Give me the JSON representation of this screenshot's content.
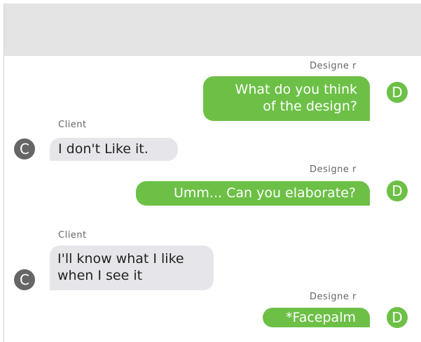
{
  "header": {
    "title": ""
  },
  "messages": [
    {
      "from": "designer",
      "sender": "Designe r",
      "lines": [
        "What do you think",
        "of the design?"
      ],
      "avatar": "D"
    },
    {
      "from": "client",
      "sender": "Client",
      "lines": [
        "I don't Like it."
      ],
      "avatar": "C"
    },
    {
      "from": "designer",
      "sender": "Designe r",
      "lines": [
        "Umm... Can you elaborate?"
      ],
      "avatar": "D"
    },
    {
      "from": "client",
      "sender": "Client",
      "lines": [
        "I'll know what I like",
        "when I see it"
      ],
      "avatar": "C"
    },
    {
      "from": "designer",
      "sender": "Designe r",
      "lines": [
        "*Facepalm"
      ],
      "avatar": "D"
    }
  ],
  "colors": {
    "designer_bubble": "#6cc046",
    "client_bubble": "#e6e6ea",
    "client_avatar": "#666666",
    "header": "#e4e4e4"
  }
}
